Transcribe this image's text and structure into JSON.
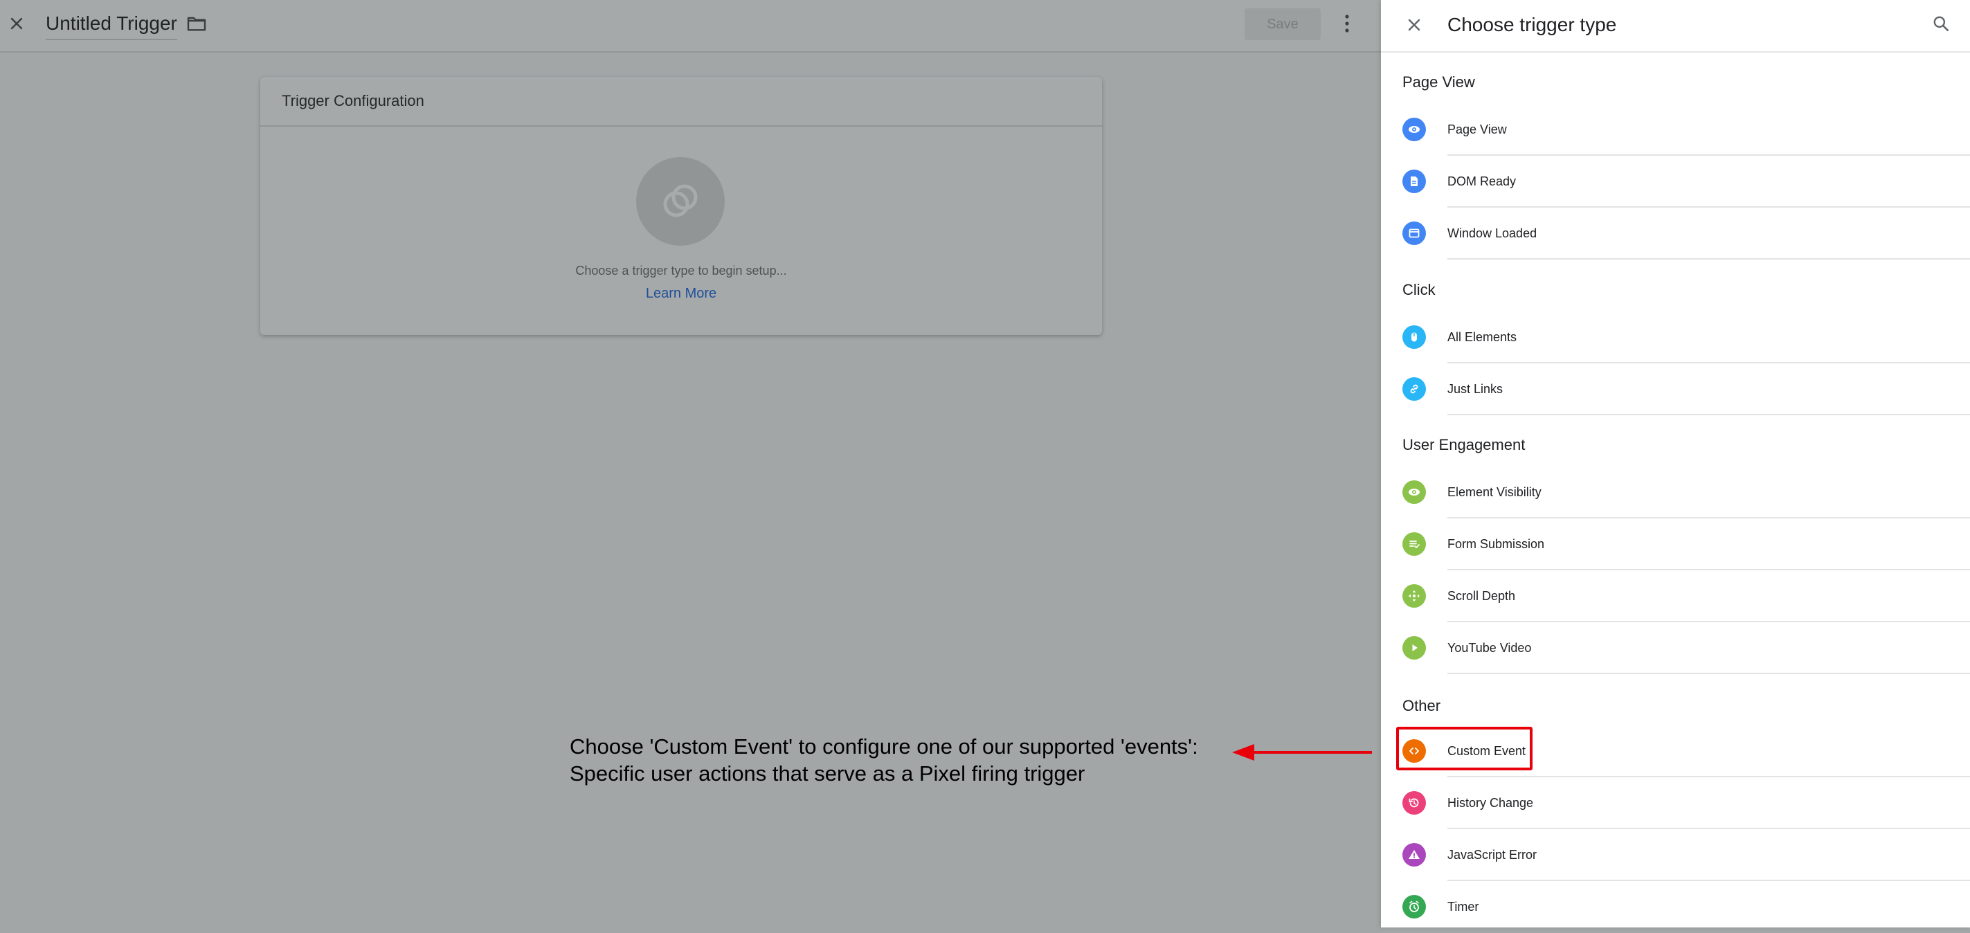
{
  "editor": {
    "title": "Untitled Trigger",
    "save_label": "Save",
    "card_title": "Trigger Configuration",
    "card_hint": "Choose a trigger type to begin setup...",
    "card_link": "Learn More"
  },
  "annotation": {
    "line1": "Choose 'Custom Event' to configure one of our supported 'events':",
    "line2": "Specific user actions that serve as a Pixel firing trigger",
    "color": "#e8000b"
  },
  "panel": {
    "title": "Choose trigger type",
    "sections": [
      {
        "label": "Page View",
        "items": [
          {
            "label": "Page View",
            "icon": "eye-icon",
            "color": "#4285f4"
          },
          {
            "label": "DOM Ready",
            "icon": "document-icon",
            "color": "#4285f4"
          },
          {
            "label": "Window Loaded",
            "icon": "window-icon",
            "color": "#4285f4"
          }
        ]
      },
      {
        "label": "Click",
        "items": [
          {
            "label": "All Elements",
            "icon": "mouse-icon",
            "color": "#29b6f6"
          },
          {
            "label": "Just Links",
            "icon": "link-icon",
            "color": "#29b6f6"
          }
        ]
      },
      {
        "label": "User Engagement",
        "items": [
          {
            "label": "Element Visibility",
            "icon": "eye-icon",
            "color": "#8bc34a"
          },
          {
            "label": "Form Submission",
            "icon": "form-icon",
            "color": "#8bc34a"
          },
          {
            "label": "Scroll Depth",
            "icon": "move-icon",
            "color": "#8bc34a"
          },
          {
            "label": "YouTube Video",
            "icon": "play-icon",
            "color": "#8bc34a"
          }
        ]
      },
      {
        "label": "Other",
        "items": [
          {
            "label": "Custom Event",
            "icon": "code-icon",
            "color": "#ef6c00"
          },
          {
            "label": "History Change",
            "icon": "history-icon",
            "color": "#ec407a"
          },
          {
            "label": "JavaScript Error",
            "icon": "warning-icon",
            "color": "#ab47bc"
          },
          {
            "label": "Timer",
            "icon": "clock-icon",
            "color": "#34a853"
          }
        ]
      }
    ]
  }
}
